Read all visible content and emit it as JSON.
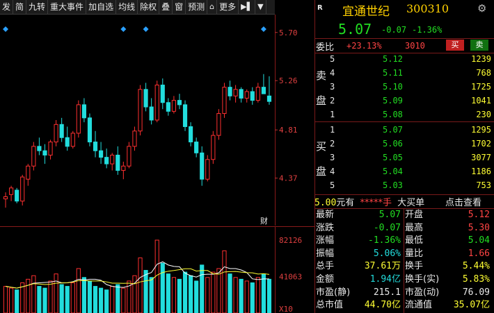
{
  "toolbar": {
    "items": [
      "发",
      "简",
      "九转",
      "重大事件",
      "加自选",
      "均线",
      "除权",
      "叠",
      "窗",
      "预测",
      "更多"
    ]
  },
  "price_axis": [
    "5.70",
    "5.26",
    "4.81",
    "4.37"
  ],
  "price_axis_tag": "财",
  "volume_axis": [
    "82126",
    "41063",
    "X10"
  ],
  "stock": {
    "flag": "R",
    "name": "宜通世纪",
    "code": "300310",
    "price": "5.07",
    "change": "-0.07",
    "change_pct": "-1.36%"
  },
  "order_ratio": {
    "label": "委比",
    "ratio": "+23.13%",
    "diff": "3010",
    "buy_label": "买",
    "sell_label": "卖"
  },
  "sell_side_label": [
    "卖",
    "盘"
  ],
  "buy_side_label": [
    "买",
    "盘"
  ],
  "asks": [
    {
      "level": "5",
      "price": "5.12",
      "volume": "1239"
    },
    {
      "level": "4",
      "price": "5.11",
      "volume": "768"
    },
    {
      "level": "3",
      "price": "5.10",
      "volume": "1725"
    },
    {
      "level": "2",
      "price": "5.09",
      "volume": "1041"
    },
    {
      "level": "1",
      "price": "5.08",
      "volume": "230"
    }
  ],
  "bids": [
    {
      "level": "1",
      "price": "5.07",
      "volume": "1295"
    },
    {
      "level": "2",
      "price": "5.06",
      "volume": "1702"
    },
    {
      "level": "3",
      "price": "5.05",
      "volume": "3077"
    },
    {
      "level": "4",
      "price": "5.04",
      "volume": "1186"
    },
    {
      "level": "5",
      "price": "5.03",
      "volume": "753"
    }
  ],
  "big_order": {
    "price": "5.00",
    "unit": "元有",
    "hidden": "*****",
    "hand": "手",
    "label": "大买单",
    "link": "点击查看"
  },
  "stats": [
    {
      "l1": "最新",
      "v1": "5.07",
      "c1": "green",
      "l2": "开盘",
      "v2": "5.12",
      "c2": "red"
    },
    {
      "l1": "涨跌",
      "v1": "-0.07",
      "c1": "green",
      "l2": "最高",
      "v2": "5.30",
      "c2": "red"
    },
    {
      "l1": "涨幅",
      "v1": "-1.36%",
      "c1": "green",
      "l2": "最低",
      "v2": "5.04",
      "c2": "green"
    },
    {
      "l1": "振幅",
      "v1": "5.06%",
      "c1": "cyan",
      "l2": "量比",
      "v2": "1.66",
      "c2": "red"
    },
    {
      "l1": "总手",
      "v1": "37.61万",
      "c1": "yellow",
      "l2": "换手",
      "v2": "5.44%",
      "c2": "yellow"
    },
    {
      "l1": "金额",
      "v1": "1.94亿",
      "c1": "cyan",
      "l2": "换手(实)",
      "v2": "5.83%",
      "c2": "yellow"
    },
    {
      "l1": "市盈(静)",
      "v1": "215.1",
      "c1": "white",
      "l2": "市盈(动)",
      "v2": "76.09",
      "c2": "white"
    },
    {
      "l1": "总市值",
      "v1": "44.70亿",
      "c1": "yellow",
      "l2": "流通值",
      "v2": "35.07亿",
      "c2": "yellow"
    }
  ],
  "chart_data": {
    "type": "candlestick",
    "ylim": [
      4.0,
      5.8
    ],
    "candles": [
      [
        4.18,
        4.24,
        4.1,
        4.2
      ],
      [
        4.22,
        4.3,
        4.16,
        4.28
      ],
      [
        4.26,
        4.28,
        4.14,
        4.16
      ],
      [
        4.16,
        4.4,
        4.12,
        4.38
      ],
      [
        4.36,
        4.5,
        4.3,
        4.48
      ],
      [
        4.48,
        4.7,
        4.44,
        4.66
      ],
      [
        4.66,
        4.74,
        4.58,
        4.62
      ],
      [
        4.62,
        4.68,
        4.5,
        4.58
      ],
      [
        4.58,
        4.72,
        4.54,
        4.7
      ],
      [
        4.7,
        4.9,
        4.66,
        4.86
      ],
      [
        4.86,
        4.92,
        4.7,
        4.74
      ],
      [
        4.74,
        4.84,
        4.62,
        4.66
      ],
      [
        4.66,
        4.8,
        4.64,
        4.78
      ],
      [
        4.78,
        5.08,
        4.74,
        5.04
      ],
      [
        5.04,
        5.1,
        4.88,
        4.92
      ],
      [
        4.92,
        4.96,
        4.66,
        4.7
      ],
      [
        4.7,
        4.8,
        4.56,
        4.62
      ],
      [
        4.62,
        4.7,
        4.5,
        4.56
      ],
      [
        4.56,
        4.64,
        4.46,
        4.5
      ],
      [
        4.5,
        4.6,
        4.44,
        4.58
      ],
      [
        4.58,
        4.66,
        4.4,
        4.44
      ],
      [
        4.44,
        4.52,
        4.36,
        4.48
      ],
      [
        4.48,
        4.7,
        4.46,
        4.66
      ],
      [
        4.66,
        4.84,
        4.62,
        4.8
      ],
      [
        4.8,
        5.22,
        4.76,
        5.18
      ],
      [
        5.18,
        5.24,
        4.98,
        5.02
      ],
      [
        5.02,
        5.1,
        4.86,
        4.9
      ],
      [
        4.9,
        5.26,
        4.88,
        5.22
      ],
      [
        5.22,
        5.28,
        5.0,
        5.06
      ],
      [
        5.06,
        5.1,
        4.94,
        4.98
      ],
      [
        4.98,
        5.12,
        4.96,
        5.08
      ],
      [
        5.08,
        5.14,
        5.0,
        5.04
      ],
      [
        5.04,
        5.08,
        4.8,
        4.84
      ],
      [
        4.84,
        4.88,
        4.66,
        4.7
      ],
      [
        4.7,
        4.74,
        4.56,
        4.6
      ],
      [
        4.6,
        4.66,
        4.3,
        4.36
      ],
      [
        4.36,
        4.58,
        4.34,
        4.54
      ],
      [
        4.54,
        4.8,
        4.5,
        4.76
      ],
      [
        4.76,
        5.0,
        4.72,
        4.96
      ],
      [
        4.96,
        5.24,
        4.92,
        5.2
      ],
      [
        5.2,
        5.26,
        5.08,
        5.12
      ],
      [
        5.12,
        5.22,
        5.06,
        5.18
      ],
      [
        5.18,
        5.2,
        5.06,
        5.1
      ],
      [
        5.1,
        5.18,
        5.06,
        5.16
      ],
      [
        5.16,
        5.2,
        5.04,
        5.08
      ],
      [
        5.08,
        5.24,
        5.06,
        5.2
      ],
      [
        5.2,
        5.32,
        5.14,
        5.14
      ],
      [
        5.12,
        5.3,
        5.04,
        5.07
      ]
    ],
    "volumes": [
      [
        30,
        1
      ],
      [
        28,
        1
      ],
      [
        26,
        0
      ],
      [
        34,
        1
      ],
      [
        38,
        1
      ],
      [
        42,
        1
      ],
      [
        30,
        0
      ],
      [
        28,
        0
      ],
      [
        36,
        1
      ],
      [
        44,
        1
      ],
      [
        32,
        0
      ],
      [
        30,
        0
      ],
      [
        34,
        1
      ],
      [
        50,
        1
      ],
      [
        40,
        0
      ],
      [
        36,
        0
      ],
      [
        30,
        0
      ],
      [
        28,
        0
      ],
      [
        26,
        0
      ],
      [
        30,
        1
      ],
      [
        32,
        0
      ],
      [
        28,
        1
      ],
      [
        36,
        1
      ],
      [
        42,
        1
      ],
      [
        62,
        1
      ],
      [
        48,
        0
      ],
      [
        40,
        0
      ],
      [
        82,
        1
      ],
      [
        56,
        0
      ],
      [
        44,
        0
      ],
      [
        40,
        1
      ],
      [
        38,
        0
      ],
      [
        46,
        0
      ],
      [
        42,
        0
      ],
      [
        36,
        0
      ],
      [
        54,
        0
      ],
      [
        40,
        1
      ],
      [
        46,
        1
      ],
      [
        50,
        1
      ],
      [
        70,
        1
      ],
      [
        44,
        0
      ],
      [
        40,
        1
      ],
      [
        38,
        0
      ],
      [
        36,
        1
      ],
      [
        34,
        0
      ],
      [
        40,
        1
      ],
      [
        44,
        0
      ],
      [
        38,
        0
      ]
    ],
    "markers": [
      0,
      21,
      25,
      46
    ]
  }
}
